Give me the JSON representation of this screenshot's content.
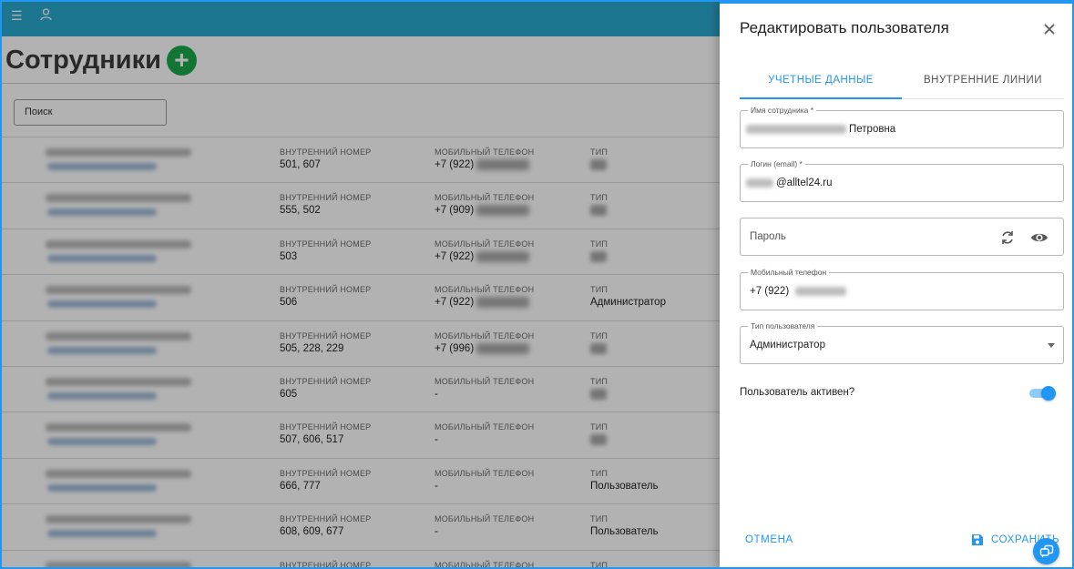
{
  "page": {
    "title": "Сотрудники",
    "add_icon": "plus-circle-icon",
    "search_placeholder": "Поиск"
  },
  "table": {
    "col_ext": "ВНУТРЕННИЙ НОМЕР",
    "col_mobile": "МОБИЛЬНЫЙ ТЕЛЕФОН",
    "col_type": "ТИП",
    "rows": [
      {
        "ext": "501, 607",
        "mobile": "+7 (922)",
        "type": ""
      },
      {
        "ext": "555, 502",
        "mobile": "+7 (909)",
        "type": ""
      },
      {
        "ext": "503",
        "mobile": "+7 (922)",
        "type": ""
      },
      {
        "ext": "506",
        "mobile": "+7 (922)",
        "type": "Администратор"
      },
      {
        "ext": "505, 228, 229",
        "mobile": "+7 (996)",
        "type": ""
      },
      {
        "ext": "605",
        "mobile": "-",
        "type": ""
      },
      {
        "ext": "507, 606, 517",
        "mobile": "-",
        "type": ""
      },
      {
        "ext": "666, 777",
        "mobile": "-",
        "type": "Пользователь"
      },
      {
        "ext": "608, 609, 677",
        "mobile": "-",
        "type": "Пользователь"
      },
      {
        "ext": "",
        "mobile": "",
        "type": ""
      }
    ]
  },
  "drawer": {
    "title": "Редактировать пользователя",
    "tabs": [
      {
        "label": "УЧЕТНЫЕ ДАННЫЕ",
        "active": true
      },
      {
        "label": "ВНУТРЕННИЕ ЛИНИИ",
        "active": false
      }
    ],
    "fields": {
      "name": {
        "label": "Имя сотрудника *",
        "value": "Петровна"
      },
      "login": {
        "label": "Логин (email) *",
        "value": "@alltel24.ru"
      },
      "password": {
        "placeholder": "Пароль"
      },
      "mobile": {
        "label": "Мобильный телефон",
        "value": "+7 (922)"
      },
      "user_type": {
        "label": "Тип пользователя",
        "value": "Администратор"
      }
    },
    "active_label": "Пользователь активен?",
    "active": true,
    "cancel_label": "ОТМЕНА",
    "save_label": "СОХРАНИТЬ"
  },
  "colors": {
    "topbar": "#2aa9cf",
    "accent": "#2196f3",
    "add_button": "#19a84b"
  }
}
